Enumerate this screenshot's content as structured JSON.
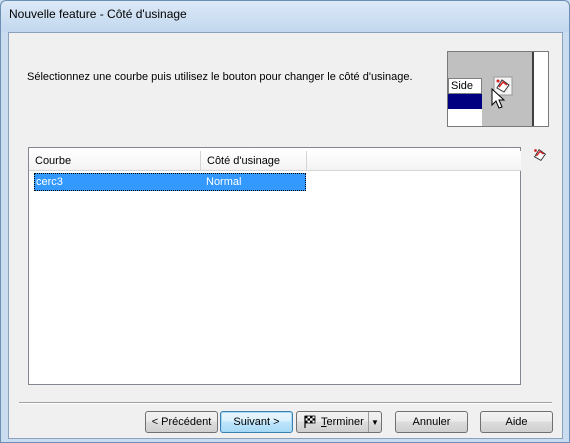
{
  "window": {
    "title": "Nouvelle feature - Côté d'usinage"
  },
  "instruction": "Sélectionnez une courbe puis utilisez le bouton pour changer le côté d'usinage.",
  "preview": {
    "header": "Side",
    "icon": "flip-side-icon"
  },
  "side_button": {
    "icon": "flip-side-icon"
  },
  "grid": {
    "columns": [
      "Courbe",
      "Côté d'usinage"
    ],
    "rows": [
      {
        "courbe": "cerc3",
        "cote": "Normal",
        "selected": true
      }
    ]
  },
  "buttons": {
    "prev": "< Précédent",
    "next": "Suivant >",
    "finish_u": "T",
    "finish_rest": "erminer",
    "finish_icon": "checkered-flag-icon",
    "cancel": "Annuler",
    "help": "Aide"
  },
  "colors": {
    "selection": "#3399ff",
    "preview_selection": "#000080"
  }
}
